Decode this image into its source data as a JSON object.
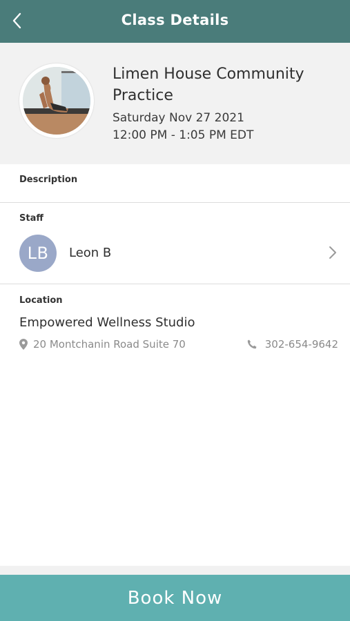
{
  "header": {
    "title": "Class Details",
    "back_icon": "chevron-left-icon"
  },
  "class": {
    "name": "Limen House Community Practice",
    "date": "Saturday Nov 27 2021",
    "time": "12:00 PM - 1:05 PM EDT"
  },
  "description": {
    "label": "Description"
  },
  "staff": {
    "label": "Staff",
    "initials": "LB",
    "name": "Leon B"
  },
  "location": {
    "label": "Location",
    "name": "Empowered Wellness Studio",
    "address": "20 Montchanin Road Suite 70",
    "phone": "302-654-9642"
  },
  "footer": {
    "book_label": "Book Now"
  },
  "colors": {
    "header_bg": "#4a7c7a",
    "book_button_bg": "#5fb0b0",
    "staff_avatar_bg": "#9aa8c8",
    "hero_bg": "#f2f2f2"
  }
}
